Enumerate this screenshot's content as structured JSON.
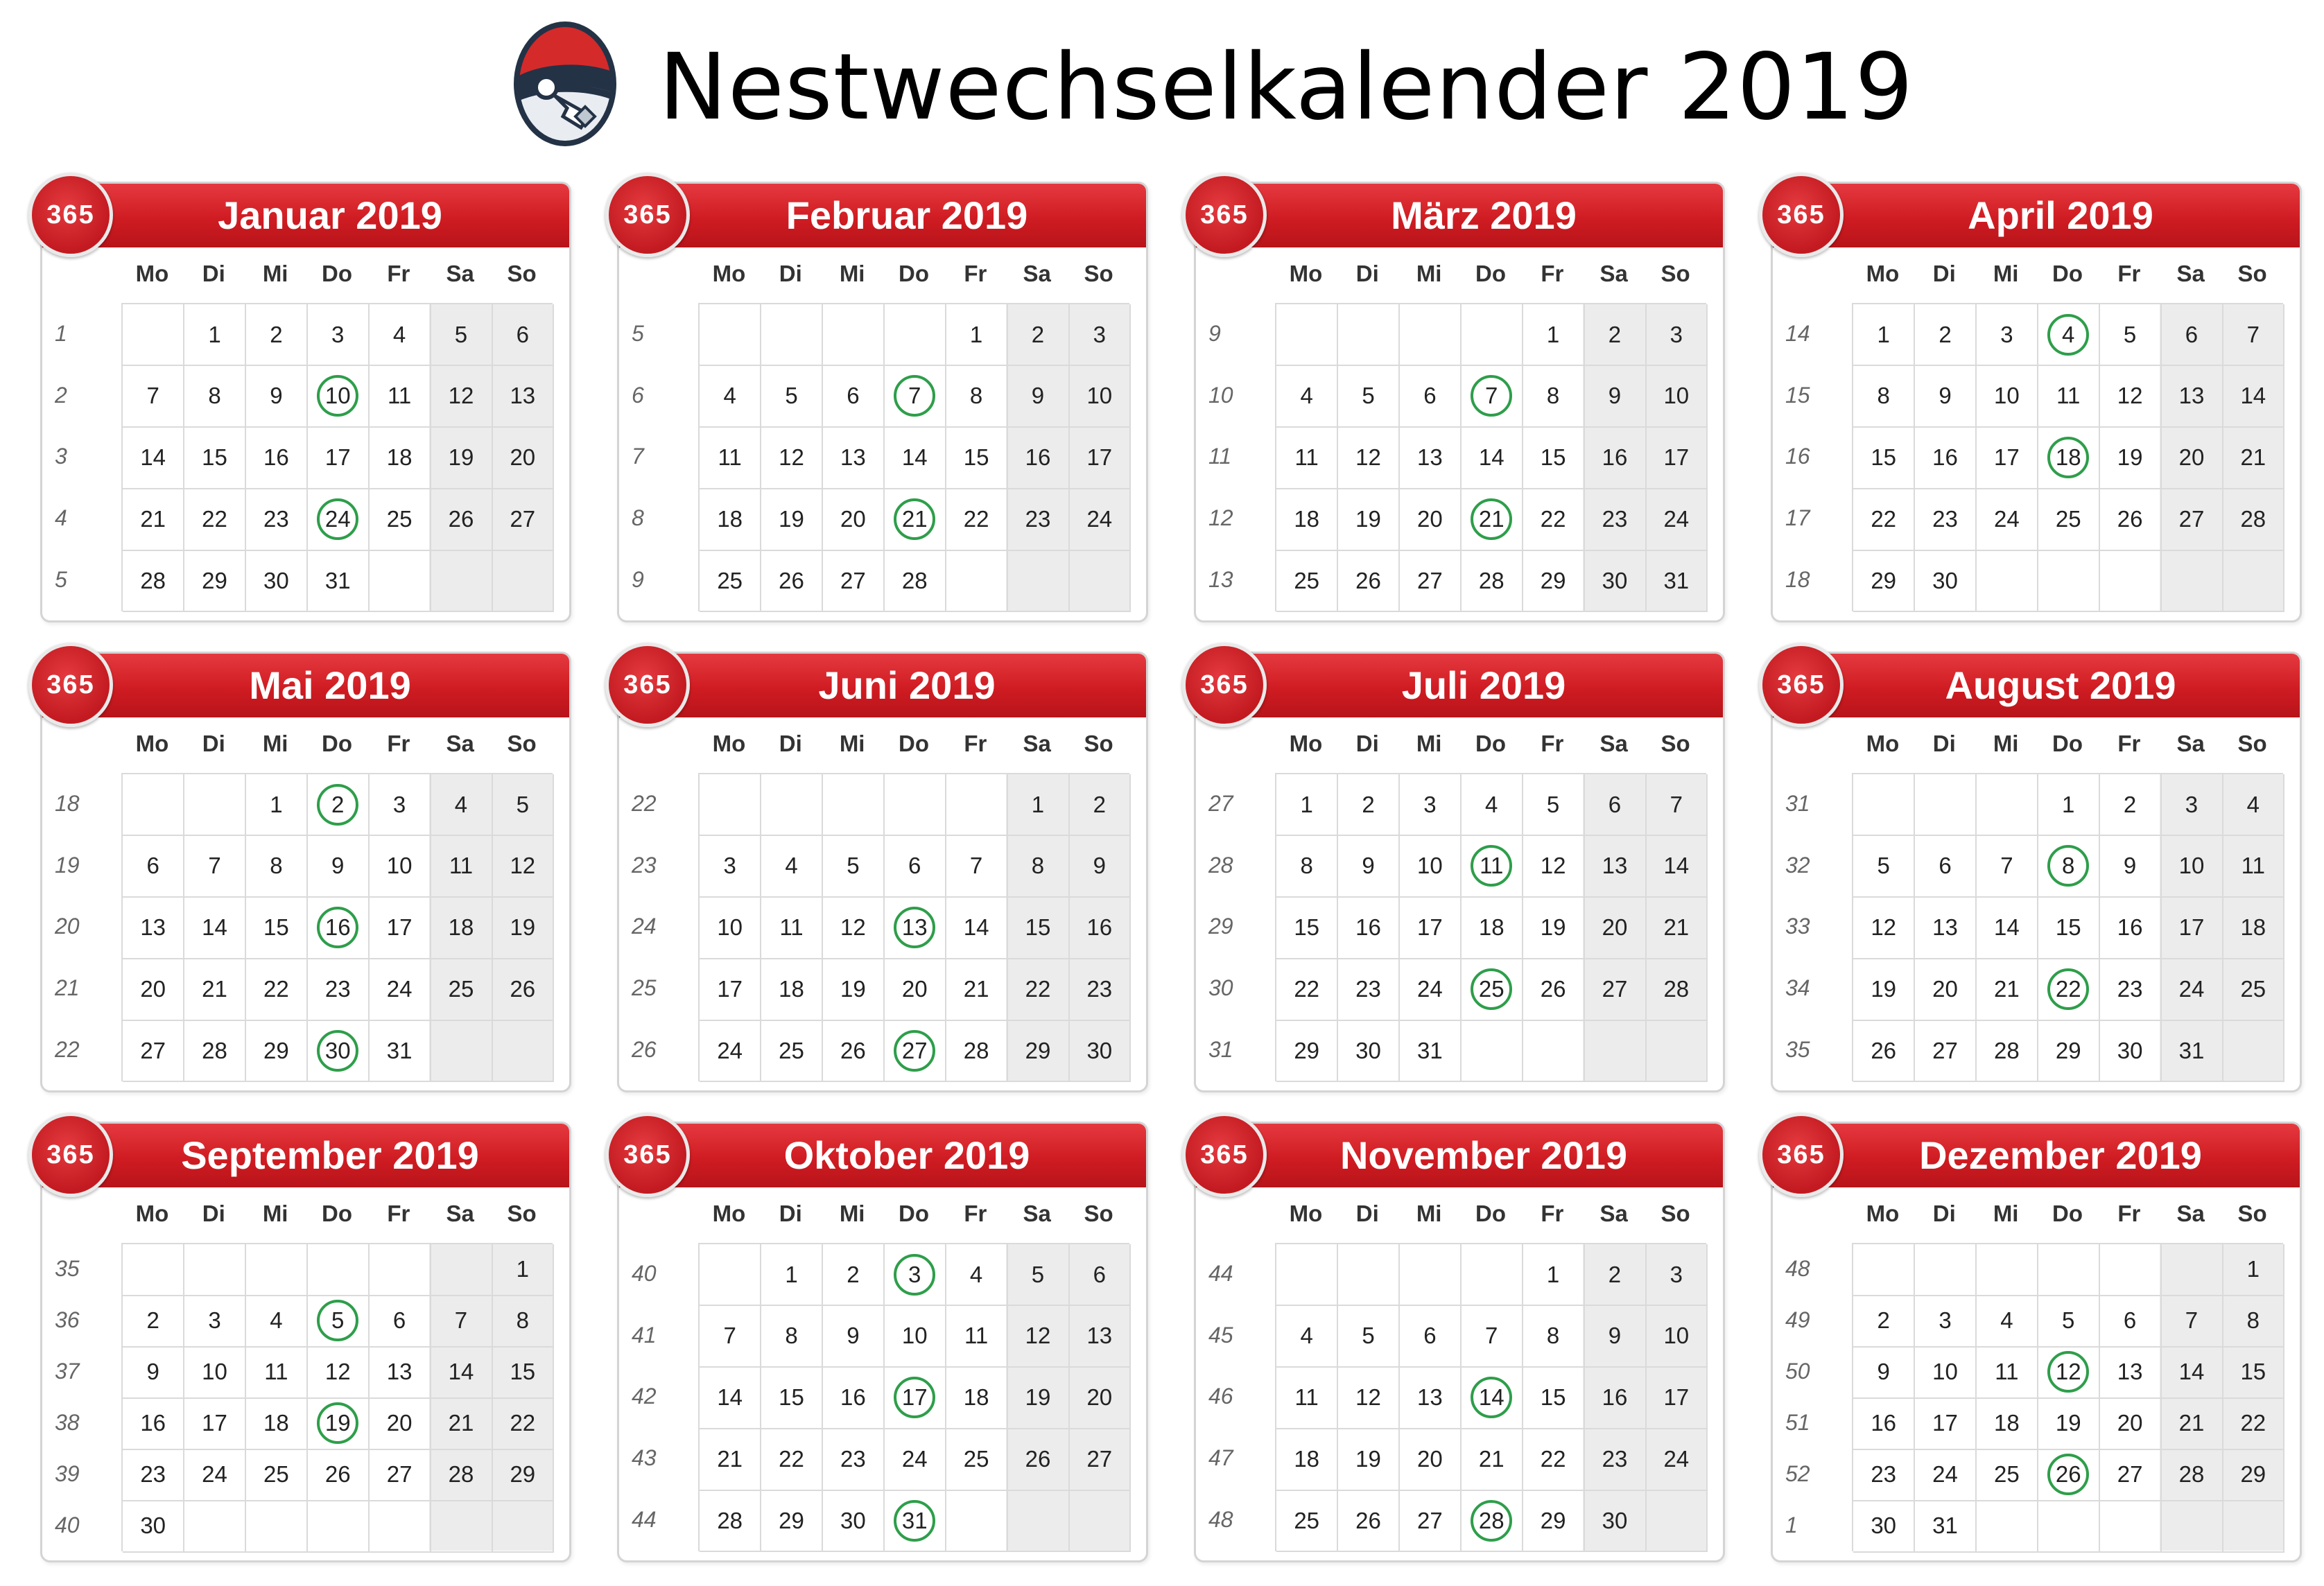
{
  "page": {
    "title": "Nestwechselkalender 2019"
  },
  "colors": {
    "header": "#cf1c22",
    "highlight_circle": "#2e9e4a",
    "weekend": "#ececec"
  },
  "badge_label": "365",
  "weekday_labels": [
    "Mo",
    "Di",
    "Mi",
    "Do",
    "Fr",
    "Sa",
    "So"
  ],
  "months": [
    {
      "title": "Januar 2019",
      "weeks": [
        1,
        2,
        3,
        4,
        5
      ],
      "rows": [
        [
          "",
          "1",
          "2",
          "3",
          "4",
          "5",
          "6"
        ],
        [
          "7",
          "8",
          "9",
          "10",
          "11",
          "12",
          "13"
        ],
        [
          "14",
          "15",
          "16",
          "17",
          "18",
          "19",
          "20"
        ],
        [
          "21",
          "22",
          "23",
          "24",
          "25",
          "26",
          "27"
        ],
        [
          "28",
          "29",
          "30",
          "31",
          "",
          "",
          ""
        ]
      ],
      "circled": [
        "10",
        "24"
      ]
    },
    {
      "title": "Februar 2019",
      "weeks": [
        5,
        6,
        7,
        8,
        9
      ],
      "rows": [
        [
          "",
          "",
          "",
          "",
          "1",
          "2",
          "3"
        ],
        [
          "4",
          "5",
          "6",
          "7",
          "8",
          "9",
          "10"
        ],
        [
          "11",
          "12",
          "13",
          "14",
          "15",
          "16",
          "17"
        ],
        [
          "18",
          "19",
          "20",
          "21",
          "22",
          "23",
          "24"
        ],
        [
          "25",
          "26",
          "27",
          "28",
          "",
          "",
          ""
        ]
      ],
      "circled": [
        "7",
        "21"
      ]
    },
    {
      "title": "März 2019",
      "weeks": [
        9,
        10,
        11,
        12,
        13
      ],
      "rows": [
        [
          "",
          "",
          "",
          "",
          "1",
          "2",
          "3"
        ],
        [
          "4",
          "5",
          "6",
          "7",
          "8",
          "9",
          "10"
        ],
        [
          "11",
          "12",
          "13",
          "14",
          "15",
          "16",
          "17"
        ],
        [
          "18",
          "19",
          "20",
          "21",
          "22",
          "23",
          "24"
        ],
        [
          "25",
          "26",
          "27",
          "28",
          "29",
          "30",
          "31"
        ]
      ],
      "circled": [
        "7",
        "21"
      ]
    },
    {
      "title": "April 2019",
      "weeks": [
        14,
        15,
        16,
        17,
        18
      ],
      "rows": [
        [
          "1",
          "2",
          "3",
          "4",
          "5",
          "6",
          "7"
        ],
        [
          "8",
          "9",
          "10",
          "11",
          "12",
          "13",
          "14"
        ],
        [
          "15",
          "16",
          "17",
          "18",
          "19",
          "20",
          "21"
        ],
        [
          "22",
          "23",
          "24",
          "25",
          "26",
          "27",
          "28"
        ],
        [
          "29",
          "30",
          "",
          "",
          "",
          "",
          ""
        ]
      ],
      "circled": [
        "4",
        "18"
      ]
    },
    {
      "title": "Mai 2019",
      "weeks": [
        18,
        19,
        20,
        21,
        22
      ],
      "rows": [
        [
          "",
          "",
          "1",
          "2",
          "3",
          "4",
          "5"
        ],
        [
          "6",
          "7",
          "8",
          "9",
          "10",
          "11",
          "12"
        ],
        [
          "13",
          "14",
          "15",
          "16",
          "17",
          "18",
          "19"
        ],
        [
          "20",
          "21",
          "22",
          "23",
          "24",
          "25",
          "26"
        ],
        [
          "27",
          "28",
          "29",
          "30",
          "31",
          "",
          ""
        ]
      ],
      "circled": [
        "2",
        "16",
        "30"
      ]
    },
    {
      "title": "Juni 2019",
      "weeks": [
        22,
        23,
        24,
        25,
        26
      ],
      "rows": [
        [
          "",
          "",
          "",
          "",
          "",
          "1",
          "2"
        ],
        [
          "3",
          "4",
          "5",
          "6",
          "7",
          "8",
          "9"
        ],
        [
          "10",
          "11",
          "12",
          "13",
          "14",
          "15",
          "16"
        ],
        [
          "17",
          "18",
          "19",
          "20",
          "21",
          "22",
          "23"
        ],
        [
          "24",
          "25",
          "26",
          "27",
          "28",
          "29",
          "30"
        ]
      ],
      "circled": [
        "13",
        "27"
      ]
    },
    {
      "title": "Juli 2019",
      "weeks": [
        27,
        28,
        29,
        30,
        31
      ],
      "rows": [
        [
          "1",
          "2",
          "3",
          "4",
          "5",
          "6",
          "7"
        ],
        [
          "8",
          "9",
          "10",
          "11",
          "12",
          "13",
          "14"
        ],
        [
          "15",
          "16",
          "17",
          "18",
          "19",
          "20",
          "21"
        ],
        [
          "22",
          "23",
          "24",
          "25",
          "26",
          "27",
          "28"
        ],
        [
          "29",
          "30",
          "31",
          "",
          "",
          "",
          ""
        ]
      ],
      "circled": [
        "11",
        "25"
      ]
    },
    {
      "title": "August 2019",
      "weeks": [
        31,
        32,
        33,
        34,
        35
      ],
      "rows": [
        [
          "",
          "",
          "",
          "1",
          "2",
          "3",
          "4"
        ],
        [
          "5",
          "6",
          "7",
          "8",
          "9",
          "10",
          "11"
        ],
        [
          "12",
          "13",
          "14",
          "15",
          "16",
          "17",
          "18"
        ],
        [
          "19",
          "20",
          "21",
          "22",
          "23",
          "24",
          "25"
        ],
        [
          "26",
          "27",
          "28",
          "29",
          "30",
          "31",
          ""
        ]
      ],
      "circled": [
        "8",
        "22"
      ]
    },
    {
      "title": "September 2019",
      "weeks": [
        35,
        36,
        37,
        38,
        39,
        40
      ],
      "rows": [
        [
          "",
          "",
          "",
          "",
          "",
          "",
          "1"
        ],
        [
          "2",
          "3",
          "4",
          "5",
          "6",
          "7",
          "8"
        ],
        [
          "9",
          "10",
          "11",
          "12",
          "13",
          "14",
          "15"
        ],
        [
          "16",
          "17",
          "18",
          "19",
          "20",
          "21",
          "22"
        ],
        [
          "23",
          "24",
          "25",
          "26",
          "27",
          "28",
          "29"
        ],
        [
          "30",
          "",
          "",
          "",
          "",
          "",
          ""
        ]
      ],
      "circled": [
        "5",
        "19"
      ]
    },
    {
      "title": "Oktober 2019",
      "weeks": [
        40,
        41,
        42,
        43,
        44
      ],
      "rows": [
        [
          "",
          "1",
          "2",
          "3",
          "4",
          "5",
          "6"
        ],
        [
          "7",
          "8",
          "9",
          "10",
          "11",
          "12",
          "13"
        ],
        [
          "14",
          "15",
          "16",
          "17",
          "18",
          "19",
          "20"
        ],
        [
          "21",
          "22",
          "23",
          "24",
          "25",
          "26",
          "27"
        ],
        [
          "28",
          "29",
          "30",
          "31",
          "",
          "",
          ""
        ]
      ],
      "circled": [
        "3",
        "17",
        "31"
      ]
    },
    {
      "title": "November 2019",
      "weeks": [
        44,
        45,
        46,
        47,
        48
      ],
      "rows": [
        [
          "",
          "",
          "",
          "",
          "1",
          "2",
          "3"
        ],
        [
          "4",
          "5",
          "6",
          "7",
          "8",
          "9",
          "10"
        ],
        [
          "11",
          "12",
          "13",
          "14",
          "15",
          "16",
          "17"
        ],
        [
          "18",
          "19",
          "20",
          "21",
          "22",
          "23",
          "24"
        ],
        [
          "25",
          "26",
          "27",
          "28",
          "29",
          "30",
          ""
        ]
      ],
      "circled": [
        "14",
        "28"
      ]
    },
    {
      "title": "Dezember 2019",
      "weeks": [
        48,
        49,
        50,
        51,
        52,
        1
      ],
      "rows": [
        [
          "",
          "",
          "",
          "",
          "",
          "",
          "1"
        ],
        [
          "2",
          "3",
          "4",
          "5",
          "6",
          "7",
          "8"
        ],
        [
          "9",
          "10",
          "11",
          "12",
          "13",
          "14",
          "15"
        ],
        [
          "16",
          "17",
          "18",
          "19",
          "20",
          "21",
          "22"
        ],
        [
          "23",
          "24",
          "25",
          "26",
          "27",
          "28",
          "29"
        ],
        [
          "30",
          "31",
          "",
          "",
          "",
          "",
          ""
        ]
      ],
      "circled": [
        "12",
        "26"
      ]
    }
  ]
}
